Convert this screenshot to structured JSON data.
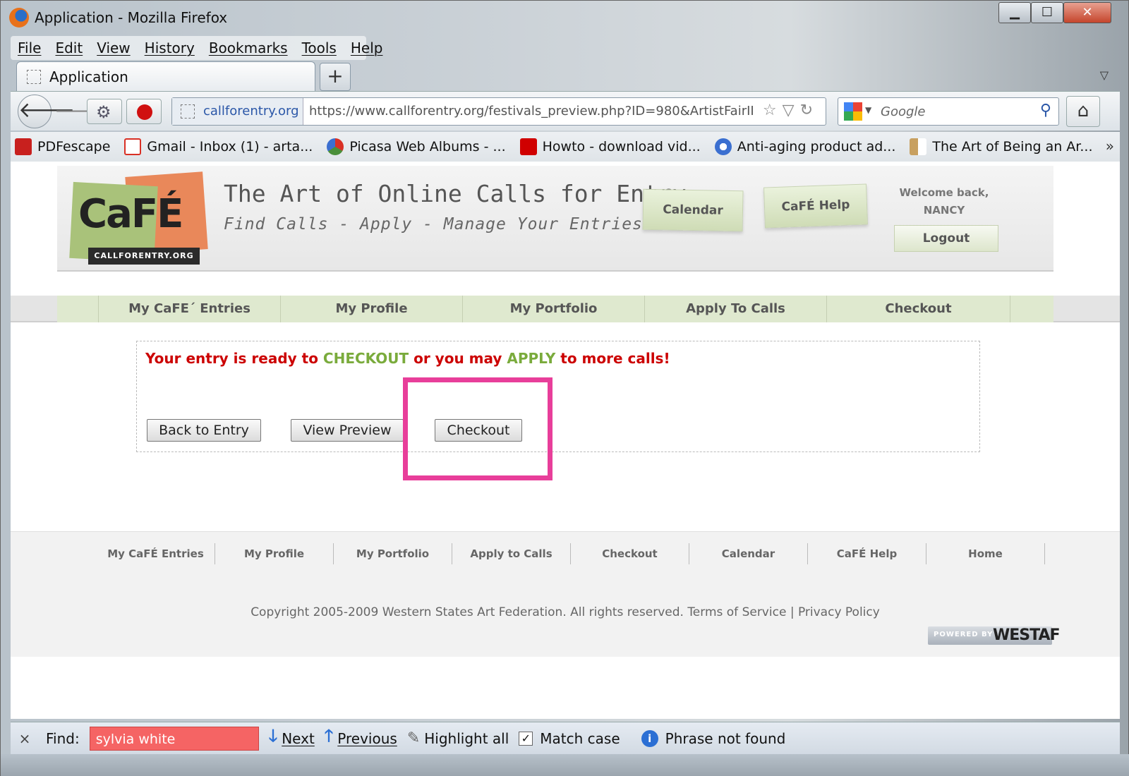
{
  "window": {
    "title": "Application - Mozilla Firefox",
    "controls": {
      "minimize": "▁",
      "maximize": "☐",
      "close": "✕"
    }
  },
  "menubar": [
    "File",
    "Edit",
    "View",
    "History",
    "Bookmarks",
    "Tools",
    "Help"
  ],
  "tabs": {
    "active_title": "Application",
    "new_tab_label": "+",
    "list_all_tabs": "▽"
  },
  "navbar": {
    "identity_domain": "callforentry.org",
    "url": "https://www.callforentry.org/festivals_preview.php?ID=980&ArtistFairII",
    "search_placeholder": "Google"
  },
  "bookmarks": [
    {
      "label": "PDFescape",
      "icon": "pdf-icon",
      "color": "#c8201e"
    },
    {
      "label": "Gmail - Inbox (1) - arta...",
      "icon": "gmail-icon",
      "color": "#d93025"
    },
    {
      "label": "Picasa Web Albums - ...",
      "icon": "picasa-icon",
      "color": "#4a8f3a"
    },
    {
      "label": "Howto - download vid...",
      "icon": "youtube-icon",
      "color": "#d00000"
    },
    {
      "label": "Anti-aging product ad...",
      "icon": "globe-icon",
      "color": "#3b6fd0"
    },
    {
      "label": "The Art of Being an Ar...",
      "icon": "bookmark-icon",
      "color": "#c8a060"
    }
  ],
  "site": {
    "logo_text": "CaFÉ",
    "logo_sub": "CALLFORENTRY.ORG",
    "tagline": "The Art of Online Calls for Entry",
    "tagline_sub": "Find Calls - Apply - Manage Your Entries",
    "header_buttons": {
      "calendar": "Calendar",
      "help": "CaFÉ Help"
    },
    "welcome_line1": "Welcome back,",
    "welcome_name": "NANCY",
    "logout": "Logout",
    "nav": [
      "My CaFE´ Entries",
      "My Profile",
      "My Portfolio",
      "Apply To Calls",
      "Checkout"
    ],
    "notice": {
      "part1": "Your entry is ready to ",
      "checkout_word": "CHECKOUT",
      "part2": " or you may ",
      "apply_word": "APPLY",
      "part3": " to more calls!"
    },
    "buttons": {
      "back": "Back to Entry",
      "preview": "View Preview",
      "checkout": "Checkout"
    },
    "footer_links": [
      "My CaFÉ Entries",
      "My Profile",
      "My Portfolio",
      "Apply to Calls",
      "Checkout",
      "Calendar",
      "CaFÉ Help",
      "Home"
    ],
    "copyright": "Copyright 2005-2009 Western States Art Federation. All rights reserved.",
    "terms": "Terms of Service",
    "separator": "|",
    "privacy": "Privacy Policy",
    "powered_by": "POWERED BY",
    "westaf": "WESTAF"
  },
  "findbar": {
    "close": "×",
    "label": "Find:",
    "query": "sylvia white",
    "next": "Next",
    "previous": "Previous",
    "highlight_all": "Highlight all",
    "match_case": "Match case",
    "match_case_checked": true,
    "status": "Phrase not found"
  },
  "colors": {
    "accent_red": "#cc0000",
    "accent_green": "#7aab3c",
    "highlight_pink": "#e83e9a",
    "find_error": "#f56464"
  }
}
